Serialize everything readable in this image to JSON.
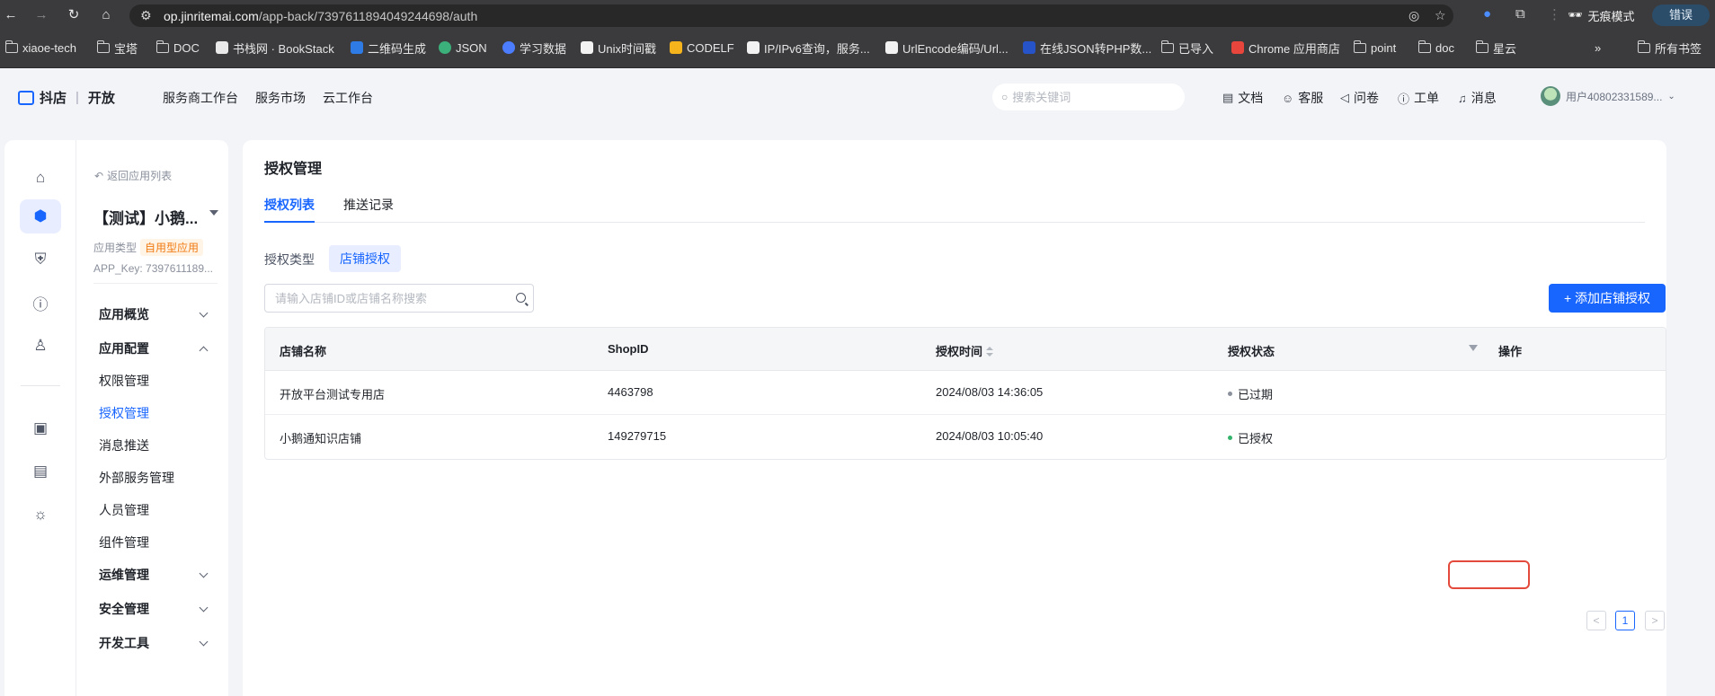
{
  "browser": {
    "url_domain": "op.jinritemai.com",
    "url_path": "/app-back/7397611894049244698/auth",
    "incognito_label": "无痕模式",
    "error_label": "错误",
    "bookmarks": [
      {
        "label": "xiaoe-tech",
        "icon": "folder"
      },
      {
        "label": "宝塔",
        "icon": "folder"
      },
      {
        "label": "DOC",
        "icon": "folder"
      },
      {
        "label": "书栈网 · BookStack",
        "icon": "bookstack"
      },
      {
        "label": "二维码生成",
        "icon": "qrcode"
      },
      {
        "label": "JSON",
        "icon": "json"
      },
      {
        "label": "学习数据",
        "icon": "study"
      },
      {
        "label": "Unix时间戳",
        "icon": "unix"
      },
      {
        "label": "CODELF",
        "icon": "codelf"
      },
      {
        "label": "IP/IPv6查询，服务...",
        "icon": "ip"
      },
      {
        "label": "UrlEncode编码/Url...",
        "icon": "urlencode"
      },
      {
        "label": "在线JSON转PHP数...",
        "icon": "json-php"
      },
      {
        "label": "已导入",
        "icon": "folder"
      },
      {
        "label": "Chrome 应用商店",
        "icon": "chrome-store"
      },
      {
        "label": "point",
        "icon": "folder"
      },
      {
        "label": "doc",
        "icon": "folder"
      },
      {
        "label": "星云",
        "icon": "folder"
      }
    ],
    "all_bookmarks_label": "所有书签"
  },
  "header": {
    "brand": "抖店",
    "brand_suffix": "开放",
    "nav": [
      "服务商工作台",
      "服务市场",
      "云工作台"
    ],
    "search_placeholder": "搜索关键词",
    "links": [
      {
        "label": "文档",
        "icon": "doc-icon"
      },
      {
        "label": "客服",
        "icon": "service-icon"
      },
      {
        "label": "问卷",
        "icon": "survey-icon"
      },
      {
        "label": "工单",
        "icon": "ticket-icon"
      },
      {
        "label": "消息",
        "icon": "bell-icon"
      }
    ],
    "user_name": "用户40802331589..."
  },
  "sidebar": {
    "back_label": "返回应用列表",
    "app_name": "【测试】小鹅...",
    "app_type_label": "应用类型",
    "app_type_value": "自用型应用",
    "app_key": "APP_Key: 7397611189...",
    "groups": {
      "overview": "应用概览",
      "config": "应用配置",
      "ops": "运维管理",
      "security": "安全管理",
      "devtools": "开发工具"
    },
    "config_items": [
      "权限管理",
      "授权管理",
      "消息推送",
      "外部服务管理",
      "人员管理",
      "组件管理"
    ],
    "active_item": "授权管理"
  },
  "main": {
    "title": "授权管理",
    "tabs": [
      "授权列表",
      "推送记录"
    ],
    "auth_type_label": "授权类型",
    "auth_type_value": "店铺授权",
    "shop_search_placeholder": "请输入店铺ID或店铺名称搜索",
    "add_button": "+ 添加店铺授权",
    "columns": [
      "店铺名称",
      "ShopID",
      "授权时间",
      "授权状态",
      "操作"
    ],
    "rows": [
      {
        "name": "开放平台测试专用店",
        "shop_id": "4463798",
        "time": "2024/08/03 14:36:05",
        "status": "已过期",
        "status_color": "#8a909c"
      },
      {
        "name": "小鹅通知识店铺",
        "shop_id": "149279715",
        "time": "2024/08/03 10:05:40",
        "status": "已授权",
        "status_color": "#34b36b"
      }
    ],
    "pagination": {
      "prev": "<",
      "current": "1",
      "next": ">"
    }
  }
}
